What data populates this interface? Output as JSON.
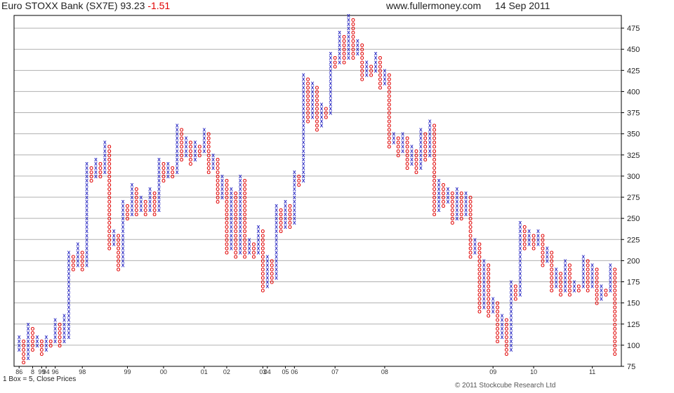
{
  "header": {
    "title": "Euro STOXX Bank (SX7E)",
    "last": "93.23",
    "change": "-1.51",
    "website": "www.fullermoney.com",
    "date": "14 Sep 2011"
  },
  "footer": {
    "box_note": "1 Box = 5, Close Prices",
    "copyright": "© 2011 Stockcube Research Ltd"
  },
  "colors": {
    "x": "#2020c0",
    "o": "#e00000",
    "grid": "#b0b0b0",
    "axis": "#000000"
  },
  "chart_data": {
    "type": "point-and-figure",
    "box_size": 5,
    "price_basis": "Close Prices",
    "ylim": [
      75,
      490
    ],
    "y_ticks": [
      75,
      100,
      125,
      150,
      175,
      200,
      225,
      250,
      275,
      300,
      325,
      350,
      375,
      400,
      425,
      450,
      475
    ],
    "x_labels": [
      {
        "col": 0,
        "label": "86"
      },
      {
        "col": 3,
        "label": "8"
      },
      {
        "col": 5,
        "label": "99"
      },
      {
        "col": 6,
        "label": "94"
      },
      {
        "col": 8,
        "label": "96"
      },
      {
        "col": 14,
        "label": "98"
      },
      {
        "col": 24,
        "label": "99"
      },
      {
        "col": 32,
        "label": "00"
      },
      {
        "col": 41,
        "label": "01"
      },
      {
        "col": 46,
        "label": "02"
      },
      {
        "col": 54,
        "label": "03"
      },
      {
        "col": 55,
        "label": "04"
      },
      {
        "col": 59,
        "label": "05"
      },
      {
        "col": 61,
        "label": "06"
      },
      {
        "col": 70,
        "label": "07"
      },
      {
        "col": 81,
        "label": "08"
      },
      {
        "col": 105,
        "label": "09"
      },
      {
        "col": 114,
        "label": "10"
      },
      {
        "col": 127,
        "label": "11"
      }
    ],
    "columns": [
      {
        "t": "X",
        "lo": 95,
        "hi": 110
      },
      {
        "t": "O",
        "lo": 80,
        "hi": 105
      },
      {
        "t": "X",
        "lo": 85,
        "hi": 125
      },
      {
        "t": "O",
        "lo": 95,
        "hi": 120
      },
      {
        "t": "X",
        "lo": 100,
        "hi": 110
      },
      {
        "t": "O",
        "lo": 90,
        "hi": 105
      },
      {
        "t": "X",
        "lo": 95,
        "hi": 110
      },
      {
        "t": "O",
        "lo": 100,
        "hi": 105
      },
      {
        "t": "X",
        "lo": 105,
        "hi": 130
      },
      {
        "t": "O",
        "lo": 100,
        "hi": 125
      },
      {
        "t": "X",
        "lo": 105,
        "hi": 135
      },
      {
        "t": "X",
        "lo": 110,
        "hi": 210
      },
      {
        "t": "O",
        "lo": 190,
        "hi": 205
      },
      {
        "t": "X",
        "lo": 195,
        "hi": 220
      },
      {
        "t": "O",
        "lo": 190,
        "hi": 210
      },
      {
        "t": "X",
        "lo": 195,
        "hi": 315
      },
      {
        "t": "O",
        "lo": 295,
        "hi": 310
      },
      {
        "t": "X",
        "lo": 300,
        "hi": 320
      },
      {
        "t": "O",
        "lo": 300,
        "hi": 315
      },
      {
        "t": "X",
        "lo": 305,
        "hi": 340
      },
      {
        "t": "O",
        "lo": 215,
        "hi": 335
      },
      {
        "t": "X",
        "lo": 220,
        "hi": 235
      },
      {
        "t": "O",
        "lo": 190,
        "hi": 230
      },
      {
        "t": "X",
        "lo": 195,
        "hi": 270
      },
      {
        "t": "O",
        "lo": 250,
        "hi": 265
      },
      {
        "t": "X",
        "lo": 255,
        "hi": 290
      },
      {
        "t": "O",
        "lo": 255,
        "hi": 285
      },
      {
        "t": "X",
        "lo": 260,
        "hi": 275
      },
      {
        "t": "O",
        "lo": 255,
        "hi": 270
      },
      {
        "t": "X",
        "lo": 260,
        "hi": 285
      },
      {
        "t": "O",
        "lo": 255,
        "hi": 280
      },
      {
        "t": "X",
        "lo": 260,
        "hi": 320
      },
      {
        "t": "O",
        "lo": 295,
        "hi": 315
      },
      {
        "t": "X",
        "lo": 300,
        "hi": 315
      },
      {
        "t": "O",
        "lo": 300,
        "hi": 310
      },
      {
        "t": "X",
        "lo": 305,
        "hi": 360
      },
      {
        "t": "O",
        "lo": 320,
        "hi": 355
      },
      {
        "t": "X",
        "lo": 325,
        "hi": 345
      },
      {
        "t": "O",
        "lo": 315,
        "hi": 340
      },
      {
        "t": "X",
        "lo": 320,
        "hi": 340
      },
      {
        "t": "O",
        "lo": 325,
        "hi": 335
      },
      {
        "t": "X",
        "lo": 330,
        "hi": 355
      },
      {
        "t": "O",
        "lo": 305,
        "hi": 350
      },
      {
        "t": "X",
        "lo": 310,
        "hi": 325
      },
      {
        "t": "O",
        "lo": 270,
        "hi": 320
      },
      {
        "t": "X",
        "lo": 275,
        "hi": 300
      },
      {
        "t": "O",
        "lo": 210,
        "hi": 295
      },
      {
        "t": "X",
        "lo": 215,
        "hi": 285
      },
      {
        "t": "O",
        "lo": 205,
        "hi": 280
      },
      {
        "t": "X",
        "lo": 210,
        "hi": 300
      },
      {
        "t": "O",
        "lo": 205,
        "hi": 295
      },
      {
        "t": "X",
        "lo": 210,
        "hi": 225
      },
      {
        "t": "O",
        "lo": 205,
        "hi": 220
      },
      {
        "t": "X",
        "lo": 210,
        "hi": 240
      },
      {
        "t": "O",
        "lo": 165,
        "hi": 235
      },
      {
        "t": "X",
        "lo": 170,
        "hi": 205
      },
      {
        "t": "O",
        "lo": 175,
        "hi": 200
      },
      {
        "t": "X",
        "lo": 180,
        "hi": 265
      },
      {
        "t": "O",
        "lo": 235,
        "hi": 260
      },
      {
        "t": "X",
        "lo": 240,
        "hi": 270
      },
      {
        "t": "O",
        "lo": 240,
        "hi": 265
      },
      {
        "t": "X",
        "lo": 245,
        "hi": 305
      },
      {
        "t": "O",
        "lo": 290,
        "hi": 300
      },
      {
        "t": "X",
        "lo": 295,
        "hi": 420
      },
      {
        "t": "O",
        "lo": 365,
        "hi": 415
      },
      {
        "t": "X",
        "lo": 370,
        "hi": 410
      },
      {
        "t": "O",
        "lo": 355,
        "hi": 405
      },
      {
        "t": "X",
        "lo": 360,
        "hi": 385
      },
      {
        "t": "O",
        "lo": 370,
        "hi": 380
      },
      {
        "t": "X",
        "lo": 375,
        "hi": 445
      },
      {
        "t": "O",
        "lo": 430,
        "hi": 440
      },
      {
        "t": "X",
        "lo": 435,
        "hi": 470
      },
      {
        "t": "O",
        "lo": 435,
        "hi": 465
      },
      {
        "t": "X",
        "lo": 440,
        "hi": 490
      },
      {
        "t": "O",
        "lo": 440,
        "hi": 485
      },
      {
        "t": "X",
        "lo": 445,
        "hi": 460
      },
      {
        "t": "O",
        "lo": 415,
        "hi": 455
      },
      {
        "t": "X",
        "lo": 420,
        "hi": 435
      },
      {
        "t": "O",
        "lo": 420,
        "hi": 430
      },
      {
        "t": "X",
        "lo": 425,
        "hi": 445
      },
      {
        "t": "O",
        "lo": 405,
        "hi": 440
      },
      {
        "t": "X",
        "lo": 410,
        "hi": 425
      },
      {
        "t": "O",
        "lo": 335,
        "hi": 420
      },
      {
        "t": "X",
        "lo": 340,
        "hi": 350
      },
      {
        "t": "O",
        "lo": 325,
        "hi": 345
      },
      {
        "t": "X",
        "lo": 330,
        "hi": 350
      },
      {
        "t": "O",
        "lo": 310,
        "hi": 345
      },
      {
        "t": "X",
        "lo": 315,
        "hi": 335
      },
      {
        "t": "O",
        "lo": 305,
        "hi": 330
      },
      {
        "t": "X",
        "lo": 310,
        "hi": 355
      },
      {
        "t": "O",
        "lo": 320,
        "hi": 350
      },
      {
        "t": "X",
        "lo": 325,
        "hi": 365
      },
      {
        "t": "O",
        "lo": 255,
        "hi": 360
      },
      {
        "t": "X",
        "lo": 260,
        "hi": 295
      },
      {
        "t": "O",
        "lo": 265,
        "hi": 290
      },
      {
        "t": "X",
        "lo": 270,
        "hi": 285
      },
      {
        "t": "O",
        "lo": 245,
        "hi": 280
      },
      {
        "t": "X",
        "lo": 250,
        "hi": 285
      },
      {
        "t": "O",
        "lo": 250,
        "hi": 280
      },
      {
        "t": "X",
        "lo": 255,
        "hi": 280
      },
      {
        "t": "O",
        "lo": 205,
        "hi": 275
      },
      {
        "t": "X",
        "lo": 210,
        "hi": 225
      },
      {
        "t": "O",
        "lo": 140,
        "hi": 220
      },
      {
        "t": "X",
        "lo": 145,
        "hi": 200
      },
      {
        "t": "O",
        "lo": 135,
        "hi": 195
      },
      {
        "t": "X",
        "lo": 140,
        "hi": 155
      },
      {
        "t": "O",
        "lo": 105,
        "hi": 150
      },
      {
        "t": "X",
        "lo": 110,
        "hi": 135
      },
      {
        "t": "O",
        "lo": 90,
        "hi": 130
      },
      {
        "t": "X",
        "lo": 95,
        "hi": 175
      },
      {
        "t": "O",
        "lo": 155,
        "hi": 170
      },
      {
        "t": "X",
        "lo": 160,
        "hi": 245
      },
      {
        "t": "O",
        "lo": 215,
        "hi": 240
      },
      {
        "t": "X",
        "lo": 220,
        "hi": 235
      },
      {
        "t": "O",
        "lo": 215,
        "hi": 230
      },
      {
        "t": "X",
        "lo": 220,
        "hi": 235
      },
      {
        "t": "O",
        "lo": 195,
        "hi": 230
      },
      {
        "t": "X",
        "lo": 200,
        "hi": 215
      },
      {
        "t": "O",
        "lo": 165,
        "hi": 210
      },
      {
        "t": "X",
        "lo": 170,
        "hi": 190
      },
      {
        "t": "O",
        "lo": 160,
        "hi": 185
      },
      {
        "t": "X",
        "lo": 165,
        "hi": 200
      },
      {
        "t": "O",
        "lo": 160,
        "hi": 195
      },
      {
        "t": "X",
        "lo": 165,
        "hi": 175
      },
      {
        "t": "O",
        "lo": 165,
        "hi": 170
      },
      {
        "t": "X",
        "lo": 170,
        "hi": 205
      },
      {
        "t": "O",
        "lo": 165,
        "hi": 200
      },
      {
        "t": "X",
        "lo": 170,
        "hi": 195
      },
      {
        "t": "O",
        "lo": 150,
        "hi": 190
      },
      {
        "t": "X",
        "lo": 155,
        "hi": 170
      },
      {
        "t": "O",
        "lo": 160,
        "hi": 165
      },
      {
        "t": "X",
        "lo": 165,
        "hi": 195
      },
      {
        "t": "O",
        "lo": 90,
        "hi": 190
      }
    ]
  }
}
